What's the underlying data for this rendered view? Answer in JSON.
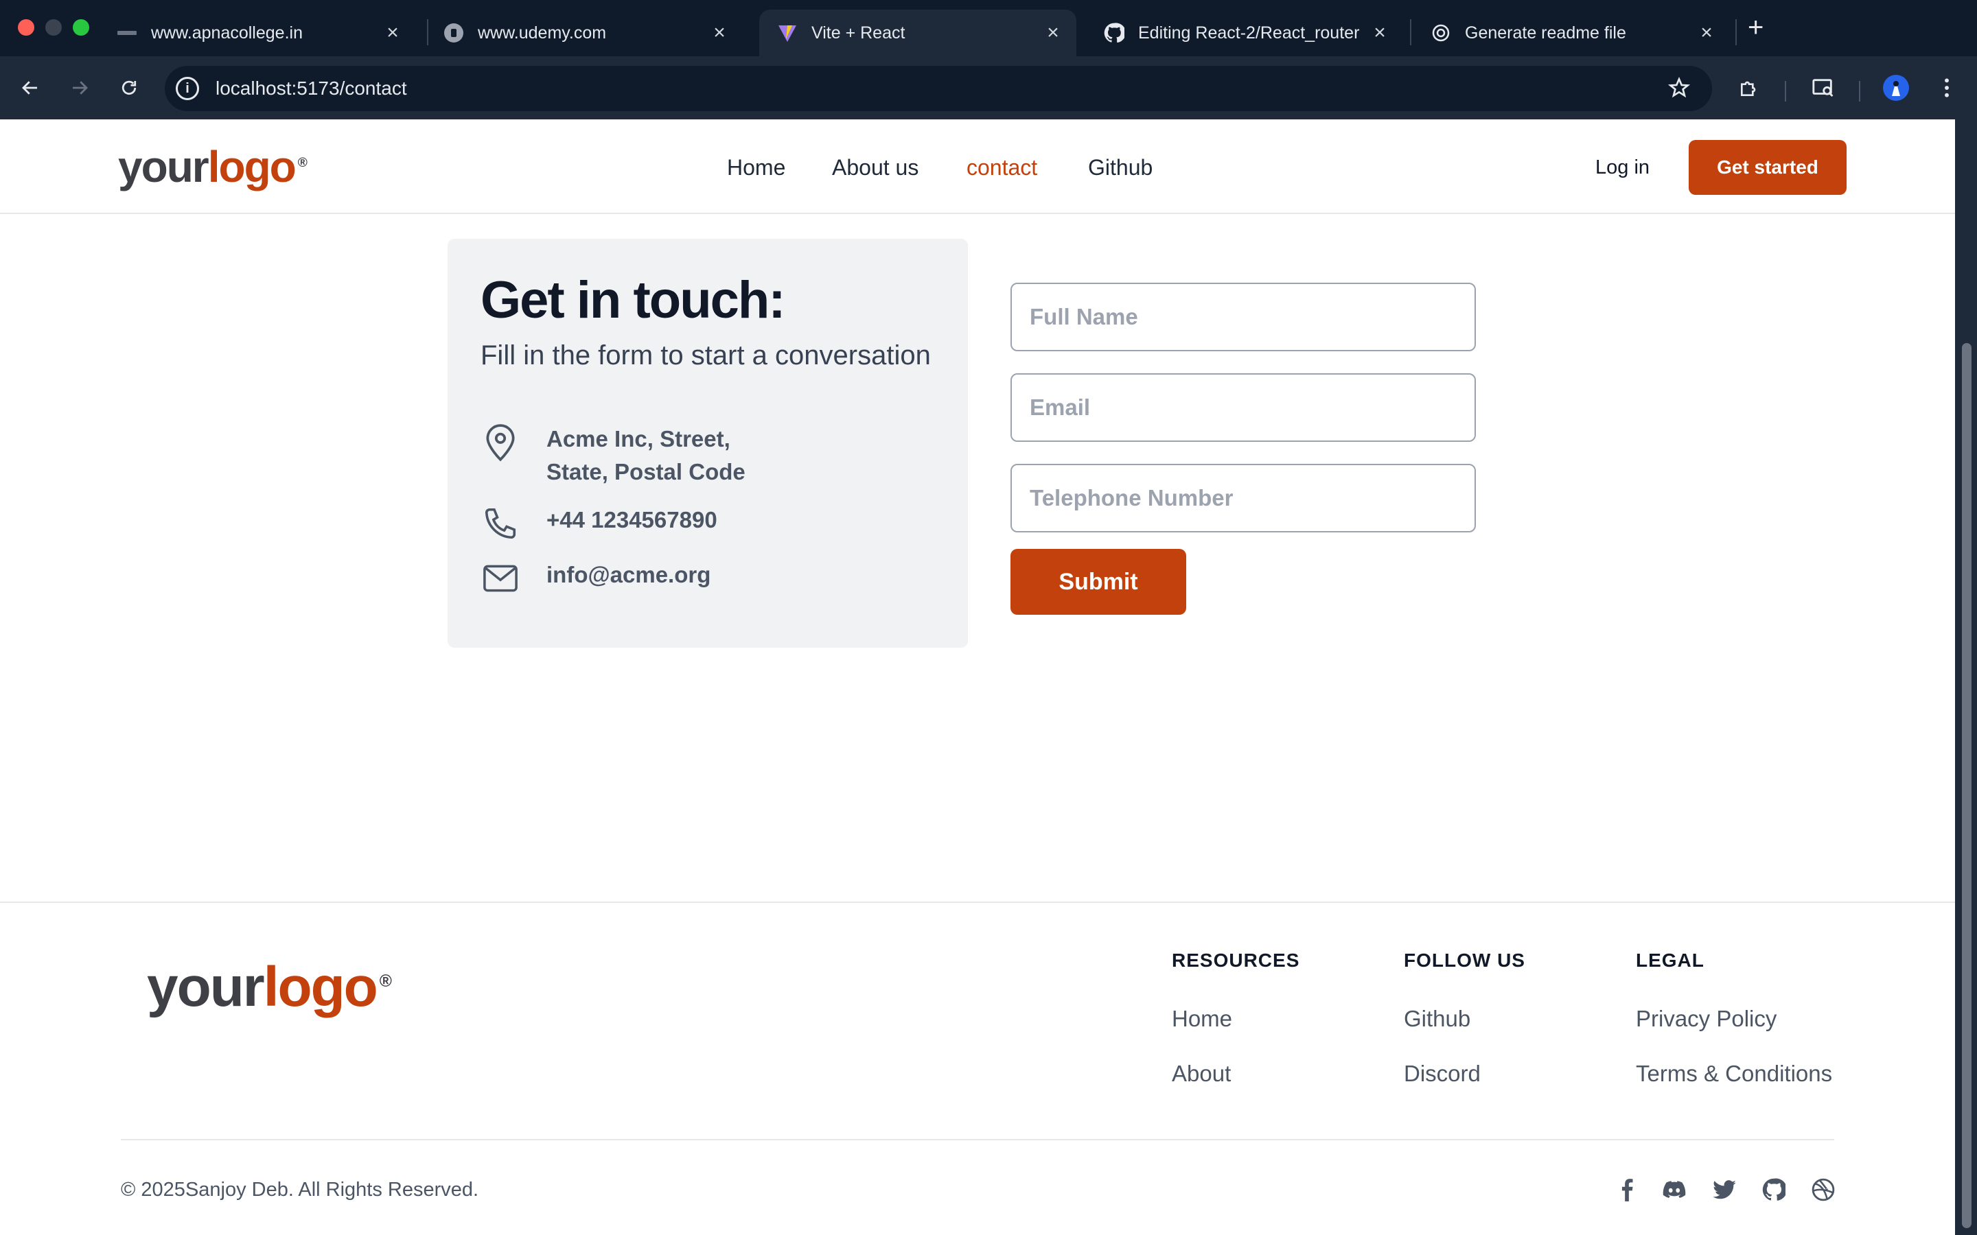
{
  "browser": {
    "tabs": [
      {
        "title": "www.apnacollege.in"
      },
      {
        "title": "www.udemy.com"
      },
      {
        "title": "Vite + React"
      },
      {
        "title": "Editing React-2/React_router"
      },
      {
        "title": "Generate readme file"
      }
    ],
    "new_tab": "+",
    "close": "×",
    "url": "localhost:5173/contact",
    "info": "i"
  },
  "header": {
    "logo_part1": "your",
    "logo_part2": "logo",
    "logo_reg": "®",
    "nav": [
      {
        "label": "Home"
      },
      {
        "label": "About us"
      },
      {
        "label": "contact"
      },
      {
        "label": "Github"
      }
    ],
    "login": "Log in",
    "cta": "Get started"
  },
  "contact": {
    "title": "Get in touch:",
    "subtitle": "Fill in the form to start a conversation",
    "address_line1": "Acme Inc, Street,",
    "address_line2": "State, Postal Code",
    "phone": "+44 1234567890",
    "email": "info@acme.org"
  },
  "form": {
    "full_name_placeholder": "Full Name",
    "email_placeholder": "Email",
    "telephone_placeholder": "Telephone Number",
    "submit": "Submit"
  },
  "footer": {
    "logo_part1": "your",
    "logo_part2": "logo",
    "logo_reg": "®",
    "resources": {
      "heading": "RESOURCES",
      "links": [
        "Home",
        "About"
      ]
    },
    "follow": {
      "heading": "FOLLOW US",
      "links": [
        "Github",
        "Discord"
      ]
    },
    "legal": {
      "heading": "LEGAL",
      "links": [
        "Privacy Policy",
        "Terms & Conditions"
      ]
    },
    "copyright": "© 2025Sanjoy Deb. All Rights Reserved.",
    "social_icons": [
      "facebook-icon",
      "discord-icon",
      "twitter-icon",
      "github-icon",
      "dribbble-icon"
    ]
  },
  "colors": {
    "accent": "#c2410c",
    "chrome_dark": "#0f1b2b",
    "chrome_toolbar": "#1e2a3a",
    "card_bg": "#f1f2f4"
  }
}
